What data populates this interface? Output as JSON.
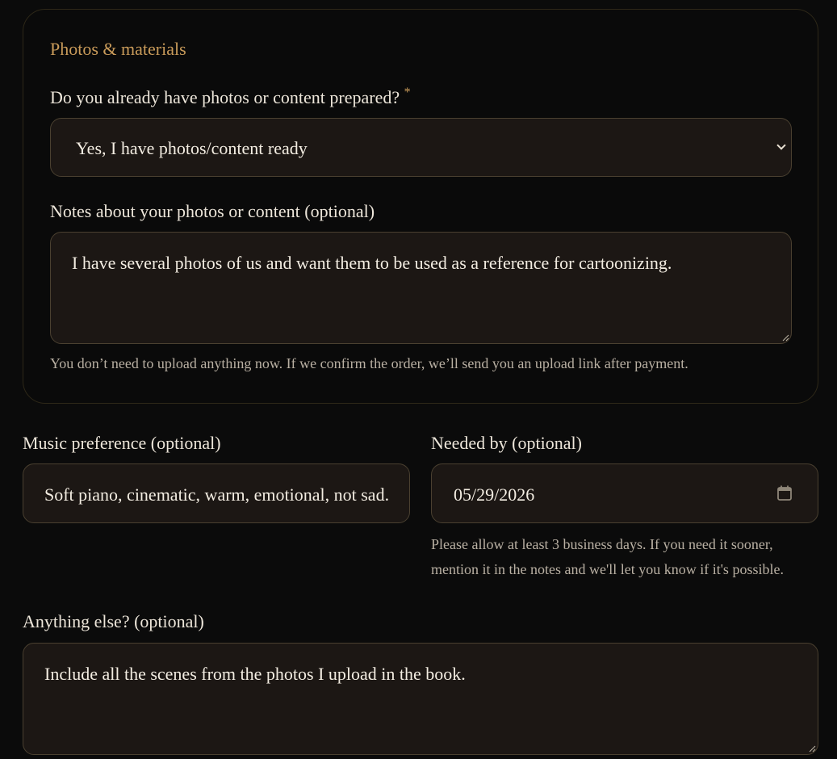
{
  "photos_section": {
    "title": "Photos & materials",
    "question_label": "Do you already have photos or content prepared?",
    "required_marker": "*",
    "selected_option": "Yes, I have photos/content ready",
    "notes_label": "Notes about your photos or content (optional)",
    "notes_value": "I have several photos of us and want them to be used as a reference for cartoonizing.",
    "help_text": "You don’t need to upload anything now. If we confirm the order, we’ll send you an upload link after payment."
  },
  "music": {
    "label": "Music preference (optional)",
    "value": "Soft piano, cinematic, warm, emotional, not sad."
  },
  "needed_by": {
    "label": "Needed by (optional)",
    "value": "05/29/2026",
    "help_line1": "Please allow at least 3 business days. If you need it sooner,",
    "help_line2": "mention it in the notes and we'll let you know if it's possible."
  },
  "anything_else": {
    "label": "Anything else? (optional)",
    "value": "Include all the scenes from the photos I upload in the book."
  },
  "icons": {
    "select_arrow": "chevron-down-icon",
    "date_picker": "calendar-icon",
    "resize": "resize-grip-icon"
  },
  "colors": {
    "accent": "#c99b5a",
    "background": "#0b0b0b",
    "field_background": "#1c1714",
    "field_border": "#4a4030"
  }
}
